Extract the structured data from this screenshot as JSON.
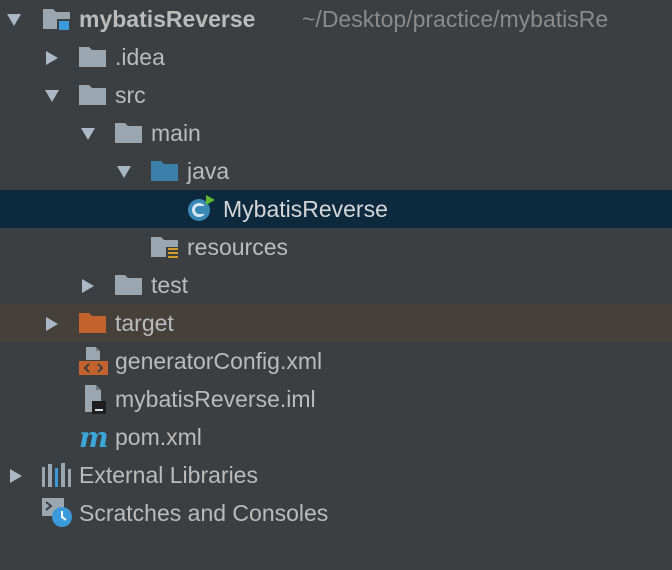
{
  "project_tree": {
    "root": {
      "label": "mybatisReverse",
      "path": "~/Desktop/practice/mybatisRe"
    },
    "idea": {
      "label": ".idea"
    },
    "src": {
      "label": "src"
    },
    "main": {
      "label": "main"
    },
    "java": {
      "label": "java"
    },
    "mybatis_reverse_class": {
      "label": "MybatisReverse"
    },
    "resources": {
      "label": "resources"
    },
    "test": {
      "label": "test"
    },
    "target": {
      "label": "target"
    },
    "generator_config": {
      "label": "generatorConfig.xml"
    },
    "iml_file": {
      "label": "mybatisReverse.iml"
    },
    "pom": {
      "label": "pom.xml"
    },
    "external_libraries": {
      "label": "External Libraries"
    },
    "scratches": {
      "label": "Scratches and Consoles"
    }
  },
  "colors": {
    "panel_bg": "#3c3f41",
    "selected_row": "#0d293e",
    "excluded_row": "#45403a",
    "text": "#bbbbbb",
    "folder_grey": "#9aa7b0",
    "source_folder_blue": "#3b7fab",
    "excluded_folder_orange": "#c3622c",
    "maven_blue": "#3aa6d9"
  },
  "icons": {
    "expanded": "triangle-down-icon",
    "collapsed": "triangle-right-icon",
    "module": "module-folder-icon",
    "folder": "folder-icon",
    "source_folder": "source-folder-icon",
    "resources_folder": "resources-folder-icon",
    "excluded_folder": "excluded-folder-icon",
    "class": "java-class-icon",
    "xml": "xml-file-icon",
    "iml": "iml-file-icon",
    "maven": "maven-icon",
    "libraries": "libraries-icon",
    "scratches": "scratches-icon"
  }
}
